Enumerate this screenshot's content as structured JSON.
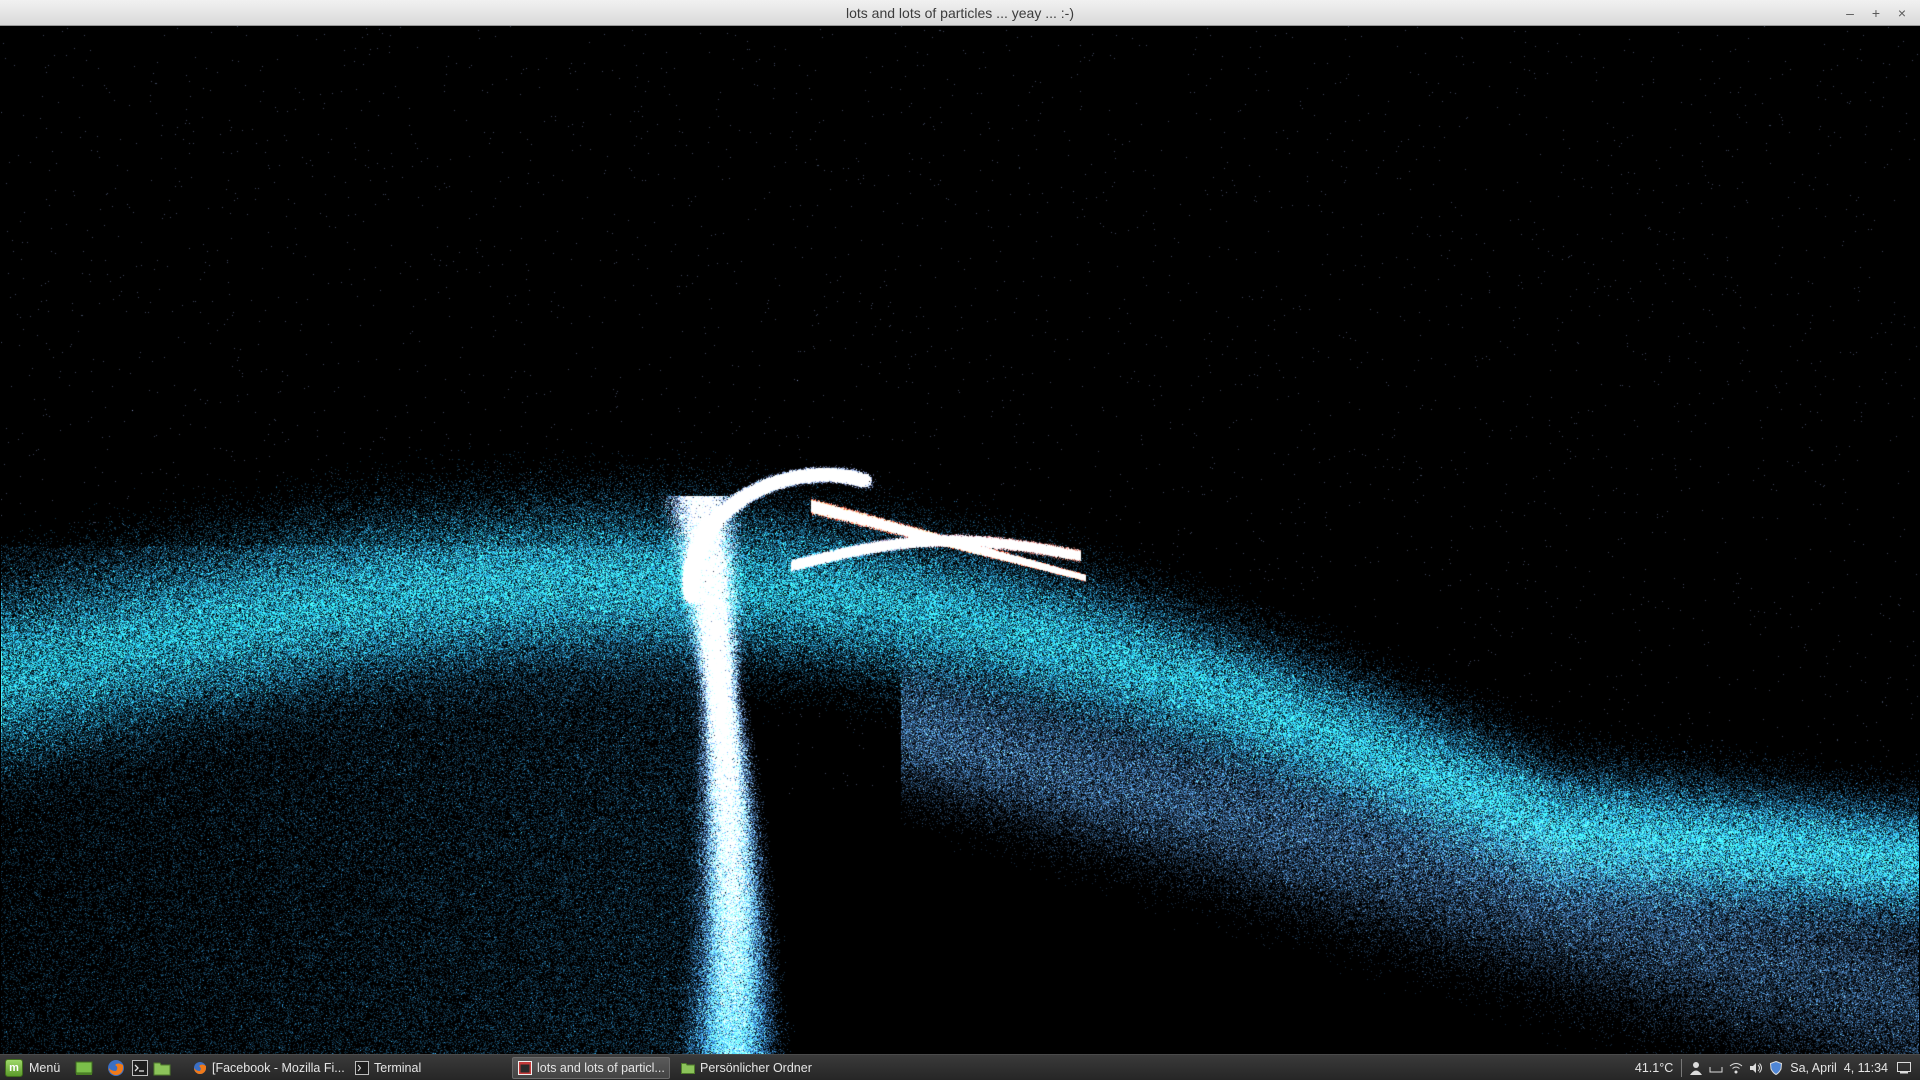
{
  "window": {
    "title": "lots and lots of particles ... yeay ... :-)",
    "minimize_glyph": "–",
    "maximize_glyph": "+",
    "close_glyph": "×"
  },
  "scene": {
    "background": "#000000",
    "particle_colors": {
      "cyan": "#2bd4ff",
      "blue": "#3a8fd8",
      "lavender": "#9aaee8",
      "red": "#e2553c",
      "pink": "#f08a7a"
    }
  },
  "taskbar": {
    "menu_label": "Menü",
    "launchers": [
      "show-desktop-icon",
      "firefox-icon",
      "terminal-icon",
      "folder-icon"
    ],
    "tasks": [
      {
        "label": "[Facebook - Mozilla Fi...",
        "icon": "firefox-icon",
        "active": false
      },
      {
        "label": "Terminal",
        "icon": "terminal-icon",
        "active": false
      },
      {
        "label": "lots and lots of particl...",
        "icon": "app-window-icon",
        "active": true
      },
      {
        "label": "Persönlicher Ordner",
        "icon": "folder-icon",
        "active": false
      }
    ],
    "temperature": "41.1°C",
    "clock": "Sa, April  4, 11:34",
    "tray_icons": [
      "user-icon",
      "keyboard-icon",
      "wifi-icon",
      "volume-icon",
      "shield-icon",
      "notification-icon"
    ]
  }
}
